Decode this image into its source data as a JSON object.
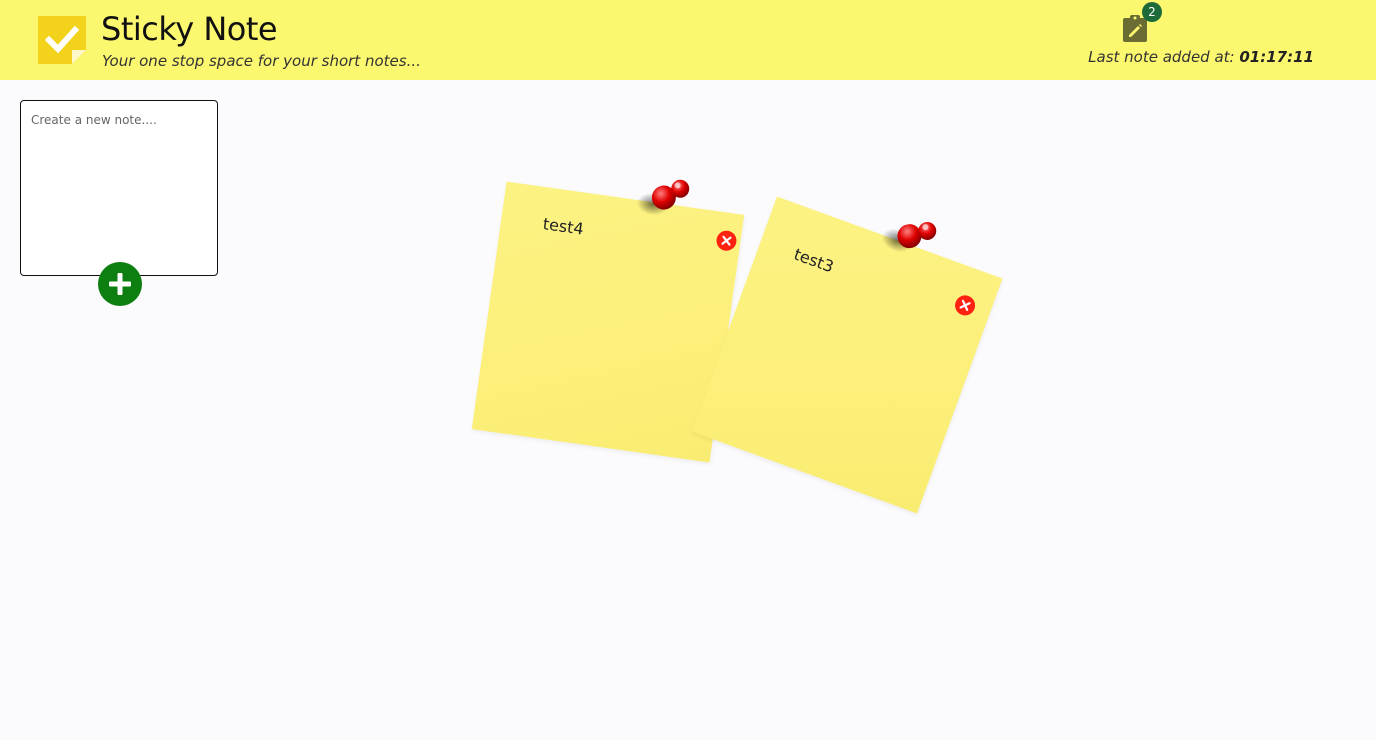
{
  "app": {
    "title": "Sticky Note",
    "tagline": "Your one stop space for your short notes..."
  },
  "header": {
    "notes_count": "2",
    "last_added_prefix": "Last note added at: ",
    "last_added_time": "01:17:11"
  },
  "composer": {
    "placeholder": "Create a new note....",
    "value": ""
  },
  "notes": [
    {
      "text": "test4"
    },
    {
      "text": "test3"
    }
  ],
  "colors": {
    "header_bg": "#fbf870",
    "note_bg": "#fcf07a",
    "add_button": "#0d7f10",
    "close_button": "#ff2211",
    "pin": "#e00000",
    "badge": "#1e6b3a"
  },
  "icons": {
    "logo": "checkmark-note-icon",
    "notes": "clipboard-edit-icon",
    "add": "plus-icon",
    "close": "close-icon",
    "pin": "pushpin-icon"
  }
}
